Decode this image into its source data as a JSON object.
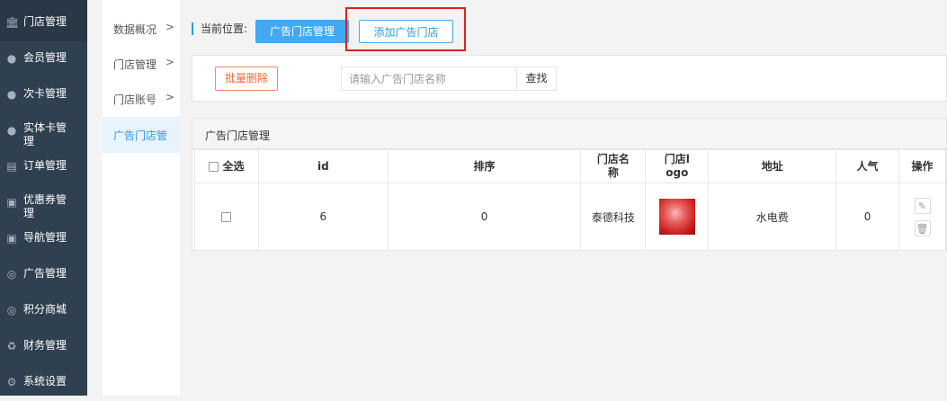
{
  "sidebar": {
    "items": [
      {
        "label": "门店管理",
        "icon": "bank-icon",
        "active": true
      },
      {
        "label": "会员管理",
        "icon": "user-icon"
      },
      {
        "label": "次卡管理",
        "icon": "user-icon"
      },
      {
        "label": "实体卡管理",
        "icon": "user-icon"
      },
      {
        "label": "订单管理",
        "icon": "document-icon"
      },
      {
        "label": "优惠券管理",
        "icon": "money-icon"
      },
      {
        "label": "导航管理",
        "icon": "money-icon"
      },
      {
        "label": "广告管理",
        "icon": "lifebuoy-icon"
      },
      {
        "label": "积分商城",
        "icon": "lifebuoy-icon"
      },
      {
        "label": "财务管理",
        "icon": "recycle-icon"
      },
      {
        "label": "系统设置",
        "icon": "gear-icon"
      }
    ]
  },
  "subnav": {
    "items": [
      {
        "label": "数据概况",
        "arrow": ">"
      },
      {
        "label": "门店管理",
        "arrow": ">"
      },
      {
        "label": "门店账号",
        "arrow": ">"
      },
      {
        "label": "广告门店管",
        "active": true
      }
    ]
  },
  "breadcrumb": {
    "label": "当前位置:"
  },
  "tabs": {
    "active": "广告门店管理",
    "add": "添加广告门店"
  },
  "toolbar": {
    "batch_delete": "批量删除",
    "search_placeholder": "请输入广告门店名称",
    "search_value": "",
    "find": "查找"
  },
  "panel": {
    "title": "广告门店管理"
  },
  "table": {
    "headers": {
      "select_all": "全选",
      "id": "id",
      "sort": "排序",
      "name": "门店名称",
      "logo": "门店logo",
      "address": "地址",
      "popularity": "人气",
      "actions": "操作"
    },
    "rows": [
      {
        "id": "6",
        "sort": "0",
        "name": "泰德科技",
        "address": "水电费",
        "popularity": "0"
      }
    ]
  },
  "colors": {
    "sidebar": "#2f4050",
    "accent": "#42a8ef",
    "danger": "#f06b3c",
    "highlight_box": "#e21f1f"
  }
}
